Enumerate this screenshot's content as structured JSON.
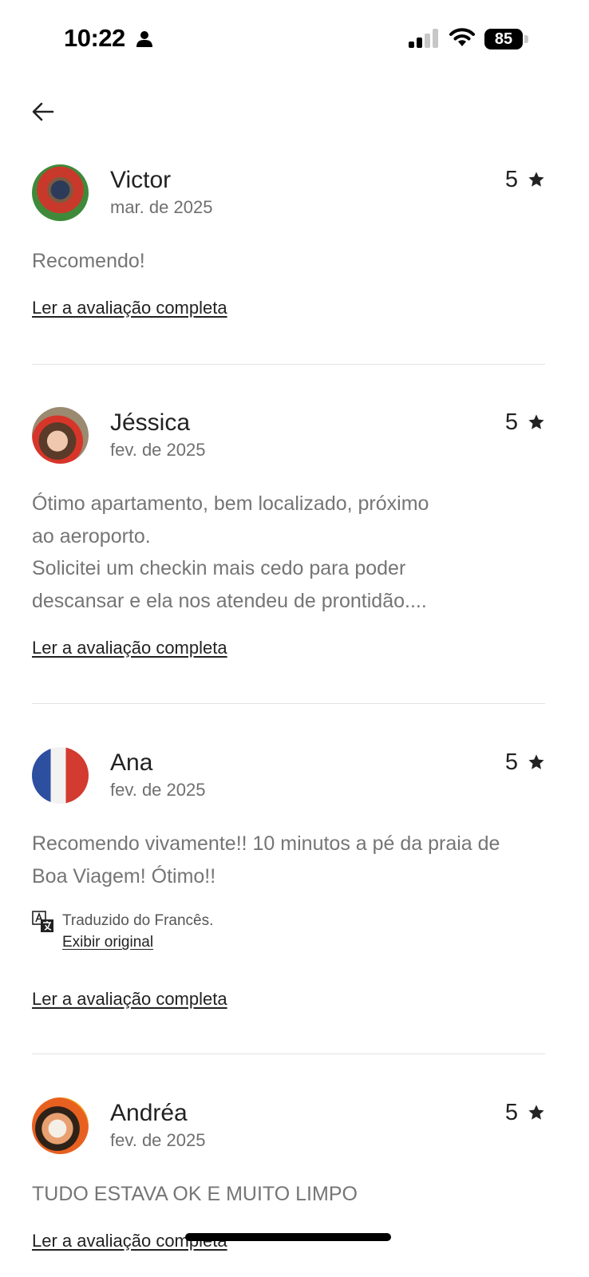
{
  "status_bar": {
    "time": "10:22",
    "battery": "85"
  },
  "reviews": [
    {
      "name": "Victor",
      "date": "mar. de 2025",
      "rating": "5",
      "text": "Recomendo!",
      "read_more": "Ler a avaliação completa"
    },
    {
      "name": "Jéssica",
      "date": "fev. de 2025",
      "rating": "5",
      "text": "Ótimo apartamento, bem localizado, próximo\nao aeroporto.\nSolicitei um checkin mais  cedo para poder\ndescansar e ela nos atendeu de prontidão....",
      "read_more": "Ler a avaliação completa"
    },
    {
      "name": "Ana",
      "date": "fev. de 2025",
      "rating": "5",
      "text": "Recomendo vivamente!! 10 minutos a pé da praia de\nBoa Viagem! Ótimo!!",
      "translation_note": "Traduzido do Francês.",
      "show_original": "Exibir original",
      "read_more": "Ler a avaliação completa"
    },
    {
      "name": "Andréa",
      "date": "fev. de 2025",
      "rating": "5",
      "text": "TUDO ESTAVA OK E MUITO LIMPO",
      "read_more": "Ler a avaliação completa"
    }
  ],
  "icons": {
    "back": "arrow-left-icon",
    "star": "star-icon",
    "translate": "translate-icon",
    "person": "person-icon",
    "signal": "cellular-signal-icon",
    "wifi": "wifi-icon"
  }
}
